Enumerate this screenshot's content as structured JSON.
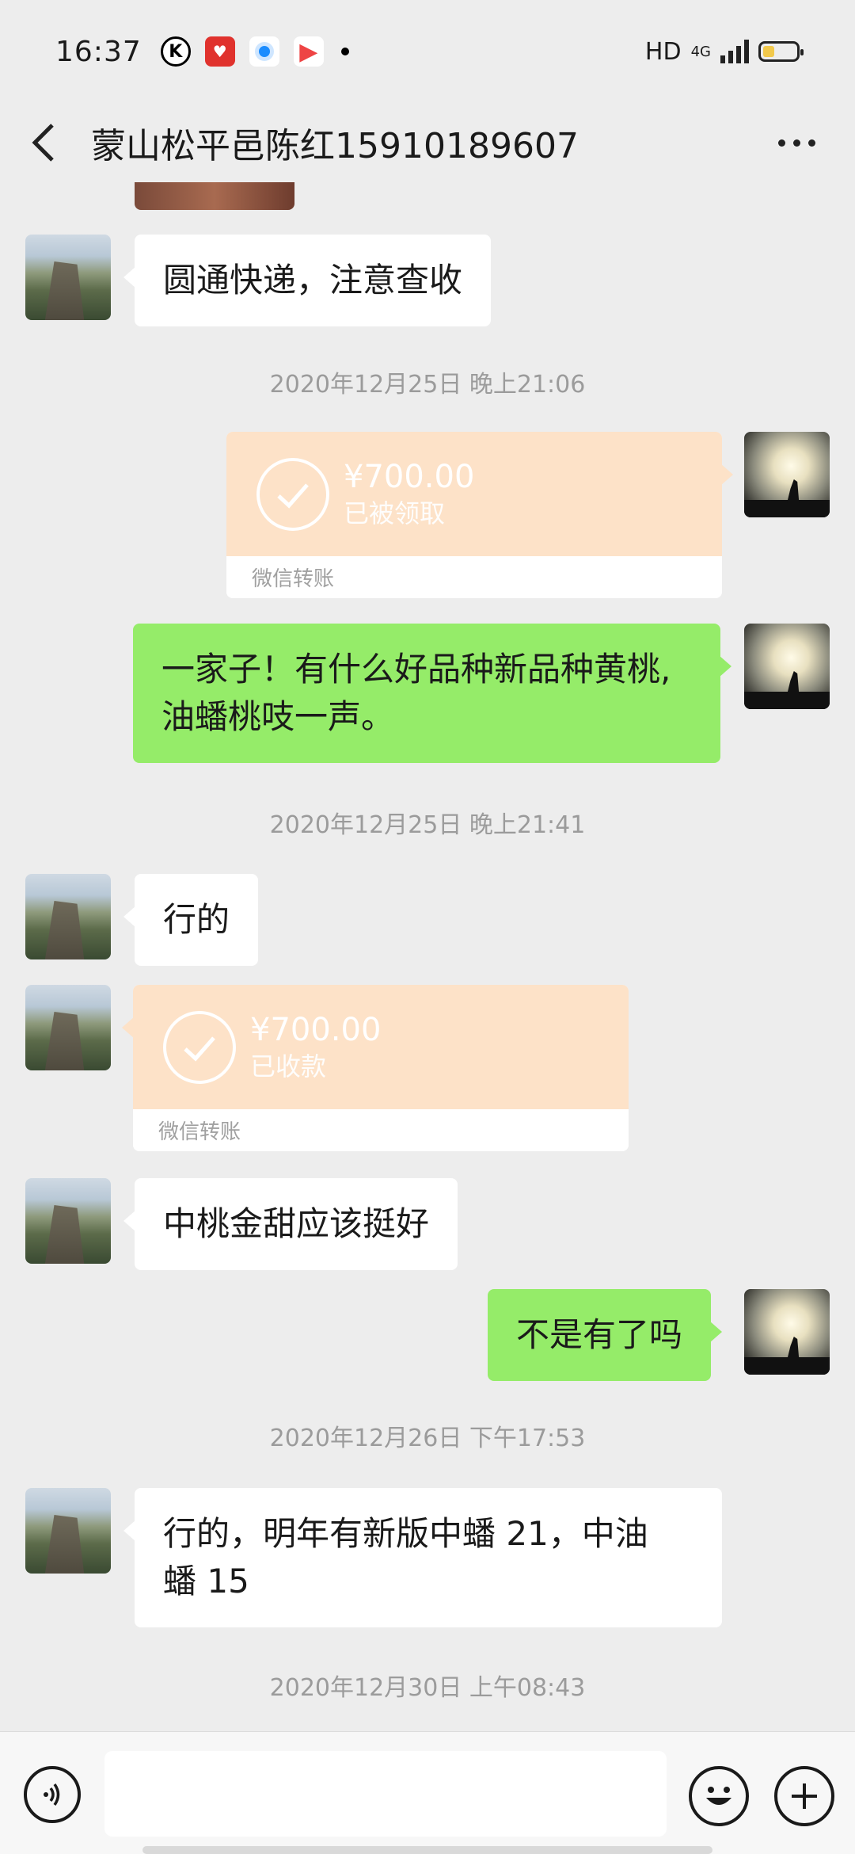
{
  "status_bar": {
    "time": "16:37",
    "hd_label": "HD",
    "network_label": "4G",
    "icons": [
      "k-circle-icon",
      "heart-app-icon",
      "blue-dot-app-icon",
      "play-app-icon",
      "bullet-icon"
    ]
  },
  "header": {
    "title": "蒙山松平邑陈红15910189607",
    "back_icon": "chevron-left-icon",
    "more_icon": "more-dots-icon"
  },
  "messages": [
    {
      "type": "text",
      "side": "left",
      "text": "圆通快递，注意查收"
    },
    {
      "type": "timestamp",
      "text": "2020年12月25日 晚上21:06"
    },
    {
      "type": "transfer",
      "side": "right",
      "amount": "¥700.00",
      "status": "已被领取",
      "footer": "微信转账"
    },
    {
      "type": "text",
      "side": "right",
      "text_line1": "一家子！有什么好品种新品种黄桃,",
      "text_line2": "油蟠桃吱一声。"
    },
    {
      "type": "timestamp",
      "text": "2020年12月25日 晚上21:41"
    },
    {
      "type": "text",
      "side": "left",
      "text": "行的"
    },
    {
      "type": "transfer",
      "side": "left",
      "amount": "¥700.00",
      "status": "已收款",
      "footer": "微信转账"
    },
    {
      "type": "text",
      "side": "left",
      "text": "中桃金甜应该挺好"
    },
    {
      "type": "text",
      "side": "right",
      "text": "不是有了吗"
    },
    {
      "type": "timestamp",
      "text": "2020年12月26日 下午17:53"
    },
    {
      "type": "text",
      "side": "left",
      "text_line1": "行的，明年有新版中蟠 21，中油",
      "text_line2": "蟠 15"
    },
    {
      "type": "timestamp",
      "text": "2020年12月30日 上午08:43"
    }
  ],
  "input_bar": {
    "placeholder": "",
    "voice_icon": "voice-icon",
    "emoji_icon": "emoji-icon",
    "plus_icon": "plus-icon"
  },
  "colors": {
    "background": "#ededed",
    "bubble_self": "#95ec69",
    "bubble_other": "#ffffff",
    "transfer": "#fde2c8",
    "timestamp": "#9b9b9b"
  }
}
